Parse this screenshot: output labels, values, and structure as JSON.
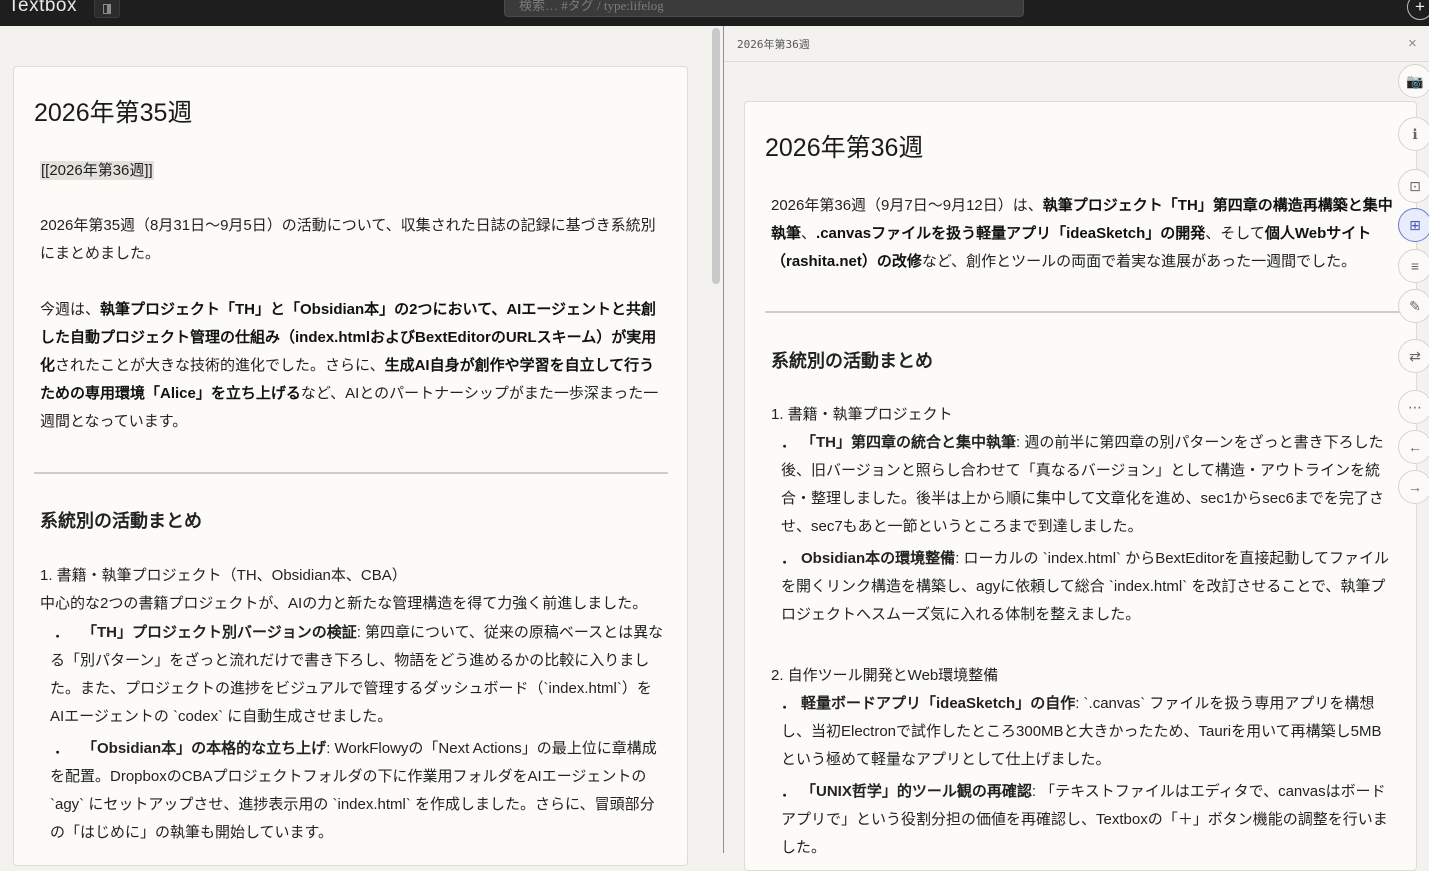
{
  "app": {
    "title": "Textbox",
    "search_placeholder": "検索… #タグ / type:lifelog",
    "add_label": "+"
  },
  "left_note": {
    "title": "2026年第35週",
    "link_chip": "[[2026年第36週]]",
    "intro": "2026年第35週（8月31日〜9月5日）の活動について、収集された日誌の記録に基づき系統別にまとめました。",
    "summary_1": "今週は、",
    "summary_2": "執筆プロジェクト「TH」と「Obsidian本」の2つにおいて、AIエージェントと共創した自動プロジェクト管理の仕組み（index.htmlおよびBextEditorのURLスキーム）が実用化",
    "summary_3": "されたことが大きな技術的進化でした。さらに、",
    "summary_4": "生成AI自身が創作や学習を自立して行うための専用環境「Alice」を立ち上げる",
    "summary_5": "など、AIとのパートナーシップがまた一歩深まった一週間となっています。",
    "section_heading": "系統別の活動まとめ",
    "item1_title": "1. 書籍・執筆プロジェクト（TH、Obsidian本、CBA）",
    "item1_lead": "中心的な2つの書籍プロジェクトが、AIの力と新たな管理構造を得て力強く前進しました。",
    "bullets": [
      {
        "dot": "．",
        "label": "「TH」プロジェクト別バージョンの検証",
        "text": ": 第四章について、従来の原稿ベースとは異なる「別パターン」をざっと流れだけで書き下ろし、物語をどう進めるかの比較に入りました。また、プロジェクトの進捗をビジュアルで管理するダッシュボード（`index.html`）をAIエージェントの `codex` に自動生成させました。"
      },
      {
        "dot": "．",
        "label": "「Obsidian本」の本格的な立ち上げ",
        "text": ": WorkFlowyの「Next Actions」の最上位に章構成を配置。DropboxのCBAプロジェクトフォルダの下に作業用フォルダをAIエージェントの `agy` にセットアップさせ、進捗表示用の `index.html` を作成しました。さらに、冒頭部分の「はじめに」の執筆も開始しています。"
      }
    ]
  },
  "right_note": {
    "header": "2026年第36週",
    "close_label": "×",
    "title": "2026年第36週",
    "summary_1": "2026年第36週（9月7日〜9月12日）は、",
    "summary_2": "執筆プロジェクト「TH」第四章の構造再構築と集中執筆",
    "summary_3": "、",
    "summary_4": ".canvasファイルを扱う軽量アプリ「ideaSketch」の開発",
    "summary_5": "、そして",
    "summary_6": "個人Webサイト（rashita.net）の改修",
    "summary_7": "など、創作とツールの両面で着実な進展があった一週間でした。",
    "section_heading": "系統別の活動まとめ",
    "item1_title": "1. 書籍・執筆プロジェクト",
    "item1_bullets": [
      {
        "dot": "．",
        "label": "「TH」第四章の統合と集中執筆",
        "text": ": 週の前半に第四章の別パターンをざっと書き下ろした後、旧バージョンと照らし合わせて「真なるバージョン」として構造・アウトラインを統合・整理しました。後半は上から順に集中して文章化を進め、sec1からsec6までを完了させ、sec7もあと一節というところまで到達しました。"
      },
      {
        "dot": "．",
        "label": "Obsidian本の環境整備",
        "text": ": ローカルの `index.html` からBextEditorを直接起動してファイルを開くリンク構造を構築し、agyに依頼して総合 `index.html` を改訂させることで、執筆プロジェクトへスムーズ気に入れる体制を整えました。"
      }
    ],
    "item2_title": "2. 自作ツール開発とWeb環境整備",
    "item2_bullets": [
      {
        "dot": "．",
        "label": "軽量ボードアプリ「ideaSketch」の自作",
        "text": ": `.canvas` ファイルを扱う専用アプリを構想し、当初Electronで試作したところ300MBと大きかったため、Tauriを用いて再構築し5MBという極めて軽量なアプリとして仕上げました。"
      },
      {
        "dot": "．",
        "label": "「UNIX哲学」的ツール観の再確認",
        "text": ": 「テキストファイルはエディタで、canvasはボードアプリで」という役割分担の価値を再確認し、Textboxの「＋」ボタン機能の調整を行いました。"
      }
    ]
  },
  "toolrail": [
    {
      "name": "camera-icon",
      "glyph": "📷"
    },
    {
      "name": "info-icon",
      "glyph": "ℹ"
    },
    {
      "name": "frame-icon",
      "glyph": "⊡"
    },
    {
      "name": "grid-icon",
      "glyph": "⊞"
    },
    {
      "name": "list-icon",
      "glyph": "≡"
    },
    {
      "name": "pencil-icon",
      "glyph": "✎"
    },
    {
      "name": "swap-icon",
      "glyph": "⇄"
    },
    {
      "name": "more-icon",
      "glyph": "⋯"
    },
    {
      "name": "back-icon",
      "glyph": "←"
    },
    {
      "name": "forward-icon",
      "glyph": "→"
    }
  ]
}
